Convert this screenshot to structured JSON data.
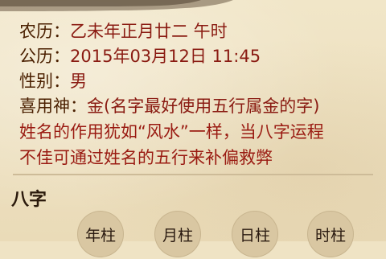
{
  "info": {
    "lunar": {
      "label": "农历：",
      "value": "乙未年正月廿二 午时"
    },
    "solar": {
      "label": "公历：",
      "value": "2015年03月12日 11:45"
    },
    "gender": {
      "label": "性别：",
      "value": "男"
    },
    "favorable": {
      "label": "喜用神：",
      "value": "金(名字最好使用五行属金的字)"
    }
  },
  "note": {
    "line1": "姓名的作用犹如“风水”一样，当八字运程",
    "line2": "不佳可通过姓名的五行来补偏救弊"
  },
  "bazi": {
    "title": "八字",
    "pillars": [
      "年柱",
      "月柱",
      "日柱",
      "时柱"
    ]
  },
  "colors": {
    "label": "#4a1f00",
    "value": "#8a1b12",
    "note": "#9a1b12",
    "background": "#efe3c4"
  }
}
